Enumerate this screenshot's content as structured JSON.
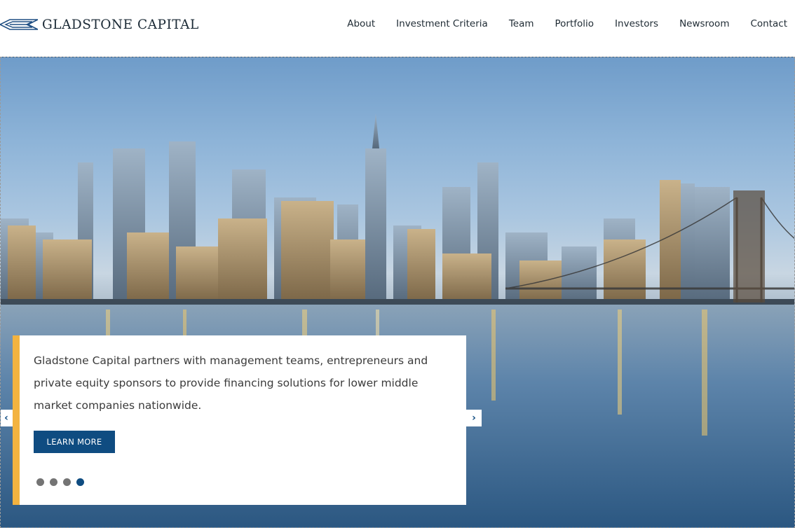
{
  "brand": {
    "name": "GLADSTONE CAPITAL",
    "logo_icon": "diamond-logo-icon",
    "accent_color": "#0f4c81",
    "highlight_color": "#f3b340"
  },
  "nav": {
    "items": [
      "About",
      "Investment Criteria",
      "Team",
      "Portfolio",
      "Investors",
      "Newsroom",
      "Contact"
    ]
  },
  "hero": {
    "image": "new-york-skyline-with-brooklyn-bridge-at-dusk",
    "caption": "Gladstone Capital partners with management teams, entrepreneurs and private equity sponsors to provide financing solutions for lower middle market companies nationwide.",
    "button_label": "LEARN MORE",
    "prev_icon": "chevron-left-icon",
    "next_icon": "chevron-right-icon",
    "prev_glyph": "‹",
    "next_glyph": "›",
    "slides_total": 4,
    "active_slide": 4
  }
}
